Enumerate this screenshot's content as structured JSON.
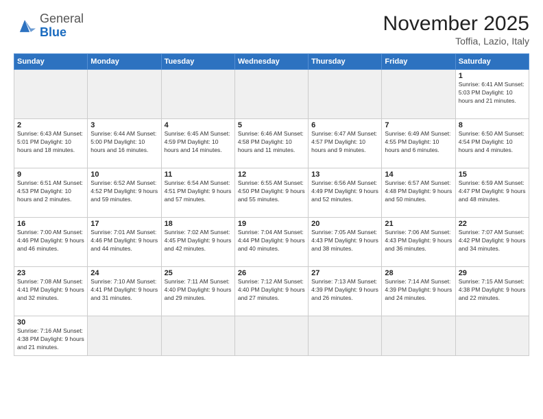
{
  "header": {
    "logo_general": "General",
    "logo_blue": "Blue",
    "month": "November 2025",
    "location": "Toffia, Lazio, Italy"
  },
  "weekdays": [
    "Sunday",
    "Monday",
    "Tuesday",
    "Wednesday",
    "Thursday",
    "Friday",
    "Saturday"
  ],
  "weeks": [
    [
      {
        "day": "",
        "info": ""
      },
      {
        "day": "",
        "info": ""
      },
      {
        "day": "",
        "info": ""
      },
      {
        "day": "",
        "info": ""
      },
      {
        "day": "",
        "info": ""
      },
      {
        "day": "",
        "info": ""
      },
      {
        "day": "1",
        "info": "Sunrise: 6:41 AM\nSunset: 5:03 PM\nDaylight: 10 hours\nand 21 minutes."
      }
    ],
    [
      {
        "day": "2",
        "info": "Sunrise: 6:43 AM\nSunset: 5:01 PM\nDaylight: 10 hours\nand 18 minutes."
      },
      {
        "day": "3",
        "info": "Sunrise: 6:44 AM\nSunset: 5:00 PM\nDaylight: 10 hours\nand 16 minutes."
      },
      {
        "day": "4",
        "info": "Sunrise: 6:45 AM\nSunset: 4:59 PM\nDaylight: 10 hours\nand 14 minutes."
      },
      {
        "day": "5",
        "info": "Sunrise: 6:46 AM\nSunset: 4:58 PM\nDaylight: 10 hours\nand 11 minutes."
      },
      {
        "day": "6",
        "info": "Sunrise: 6:47 AM\nSunset: 4:57 PM\nDaylight: 10 hours\nand 9 minutes."
      },
      {
        "day": "7",
        "info": "Sunrise: 6:49 AM\nSunset: 4:55 PM\nDaylight: 10 hours\nand 6 minutes."
      },
      {
        "day": "8",
        "info": "Sunrise: 6:50 AM\nSunset: 4:54 PM\nDaylight: 10 hours\nand 4 minutes."
      }
    ],
    [
      {
        "day": "9",
        "info": "Sunrise: 6:51 AM\nSunset: 4:53 PM\nDaylight: 10 hours\nand 2 minutes."
      },
      {
        "day": "10",
        "info": "Sunrise: 6:52 AM\nSunset: 4:52 PM\nDaylight: 9 hours\nand 59 minutes."
      },
      {
        "day": "11",
        "info": "Sunrise: 6:54 AM\nSunset: 4:51 PM\nDaylight: 9 hours\nand 57 minutes."
      },
      {
        "day": "12",
        "info": "Sunrise: 6:55 AM\nSunset: 4:50 PM\nDaylight: 9 hours\nand 55 minutes."
      },
      {
        "day": "13",
        "info": "Sunrise: 6:56 AM\nSunset: 4:49 PM\nDaylight: 9 hours\nand 52 minutes."
      },
      {
        "day": "14",
        "info": "Sunrise: 6:57 AM\nSunset: 4:48 PM\nDaylight: 9 hours\nand 50 minutes."
      },
      {
        "day": "15",
        "info": "Sunrise: 6:59 AM\nSunset: 4:47 PM\nDaylight: 9 hours\nand 48 minutes."
      }
    ],
    [
      {
        "day": "16",
        "info": "Sunrise: 7:00 AM\nSunset: 4:46 PM\nDaylight: 9 hours\nand 46 minutes."
      },
      {
        "day": "17",
        "info": "Sunrise: 7:01 AM\nSunset: 4:46 PM\nDaylight: 9 hours\nand 44 minutes."
      },
      {
        "day": "18",
        "info": "Sunrise: 7:02 AM\nSunset: 4:45 PM\nDaylight: 9 hours\nand 42 minutes."
      },
      {
        "day": "19",
        "info": "Sunrise: 7:04 AM\nSunset: 4:44 PM\nDaylight: 9 hours\nand 40 minutes."
      },
      {
        "day": "20",
        "info": "Sunrise: 7:05 AM\nSunset: 4:43 PM\nDaylight: 9 hours\nand 38 minutes."
      },
      {
        "day": "21",
        "info": "Sunrise: 7:06 AM\nSunset: 4:43 PM\nDaylight: 9 hours\nand 36 minutes."
      },
      {
        "day": "22",
        "info": "Sunrise: 7:07 AM\nSunset: 4:42 PM\nDaylight: 9 hours\nand 34 minutes."
      }
    ],
    [
      {
        "day": "23",
        "info": "Sunrise: 7:08 AM\nSunset: 4:41 PM\nDaylight: 9 hours\nand 32 minutes."
      },
      {
        "day": "24",
        "info": "Sunrise: 7:10 AM\nSunset: 4:41 PM\nDaylight: 9 hours\nand 31 minutes."
      },
      {
        "day": "25",
        "info": "Sunrise: 7:11 AM\nSunset: 4:40 PM\nDaylight: 9 hours\nand 29 minutes."
      },
      {
        "day": "26",
        "info": "Sunrise: 7:12 AM\nSunset: 4:40 PM\nDaylight: 9 hours\nand 27 minutes."
      },
      {
        "day": "27",
        "info": "Sunrise: 7:13 AM\nSunset: 4:39 PM\nDaylight: 9 hours\nand 26 minutes."
      },
      {
        "day": "28",
        "info": "Sunrise: 7:14 AM\nSunset: 4:39 PM\nDaylight: 9 hours\nand 24 minutes."
      },
      {
        "day": "29",
        "info": "Sunrise: 7:15 AM\nSunset: 4:38 PM\nDaylight: 9 hours\nand 22 minutes."
      }
    ],
    [
      {
        "day": "30",
        "info": "Sunrise: 7:16 AM\nSunset: 4:38 PM\nDaylight: 9 hours\nand 21 minutes."
      },
      {
        "day": "",
        "info": ""
      },
      {
        "day": "",
        "info": ""
      },
      {
        "day": "",
        "info": ""
      },
      {
        "day": "",
        "info": ""
      },
      {
        "day": "",
        "info": ""
      },
      {
        "day": "",
        "info": ""
      }
    ]
  ]
}
